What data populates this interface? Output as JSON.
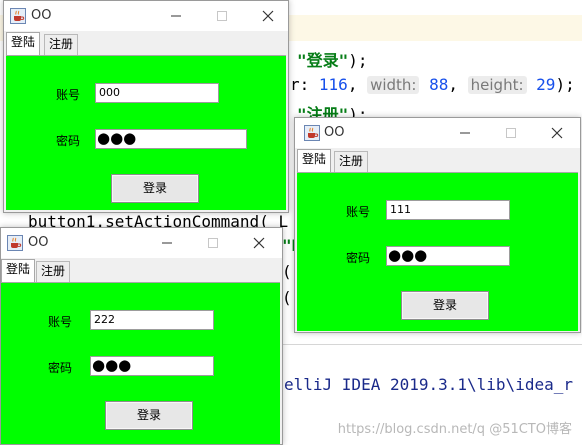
{
  "editor": {
    "lines": [
      {
        "t1": "\"登录\"",
        "t2": ");"
      },
      {
        "t0": ", ",
        "p1": "width:",
        "n1": "88",
        "sep": ", ",
        "p2": "height:",
        "n2": "29",
        "end": ");",
        "pre": "r:",
        "n0": "116"
      },
      {
        "t1": "\"注册\"",
        "t2": ");"
      },
      {
        "text": "button1.setActionCommand( L"
      },
      {
        "text": "\"R"
      },
      {
        "text": "(r"
      },
      {
        "text": "(r"
      },
      {
        "text": "elliJ IDEA 2019.3.1\\lib\\idea_r"
      }
    ],
    "watermark": "https://blog.csdn.net/q @51CTO博客"
  },
  "windows": [
    {
      "title": "OO",
      "tabs": [
        "登陆",
        "注册"
      ],
      "account_label": "账号",
      "account_value": "000",
      "password_label": "密码",
      "password_value": "●●●",
      "login_label": "登录"
    },
    {
      "title": "OO",
      "tabs": [
        "登陆",
        "注册"
      ],
      "account_label": "账号",
      "account_value": "222",
      "password_label": "密码",
      "password_value": "●●●",
      "login_label": "登录"
    },
    {
      "title": "OO",
      "tabs": [
        "登陆",
        "注册"
      ],
      "account_label": "账号",
      "account_value": "111",
      "password_label": "密码",
      "password_value": "●●●",
      "login_label": "登录"
    }
  ],
  "colors": {
    "panel_green": "#00ff00",
    "string_green": "#067d17",
    "number_blue": "#1750eb"
  },
  "icons": {
    "app": "java-cup-icon",
    "minimize": "minimize-icon",
    "maximize": "maximize-icon",
    "close": "close-icon"
  }
}
